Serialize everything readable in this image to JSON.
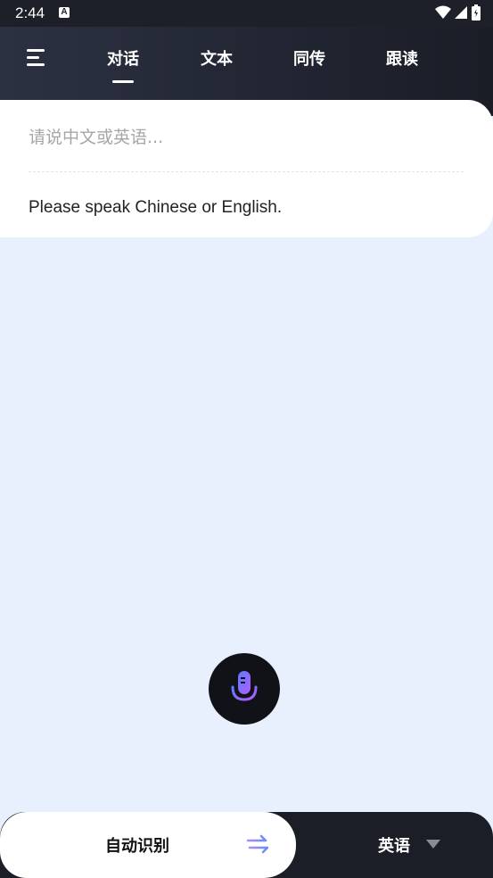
{
  "status_bar": {
    "time": "2:44",
    "notification_glyph": "A"
  },
  "nav": {
    "tabs": [
      {
        "label": "对话",
        "active": true
      },
      {
        "label": "文本",
        "active": false
      },
      {
        "label": "同传",
        "active": false
      },
      {
        "label": "跟读",
        "active": false
      }
    ]
  },
  "conversation_card": {
    "input_placeholder": "请说中文或英语...",
    "translation_placeholder": "Please speak Chinese or English."
  },
  "language_bar": {
    "source_language": "自动识别",
    "target_language": "英语"
  },
  "colors": {
    "background": "#e8f0fe",
    "header_dark": "#1d2029",
    "mic_gradient_start": "#5b7cff",
    "mic_gradient_end": "#b15cff"
  }
}
